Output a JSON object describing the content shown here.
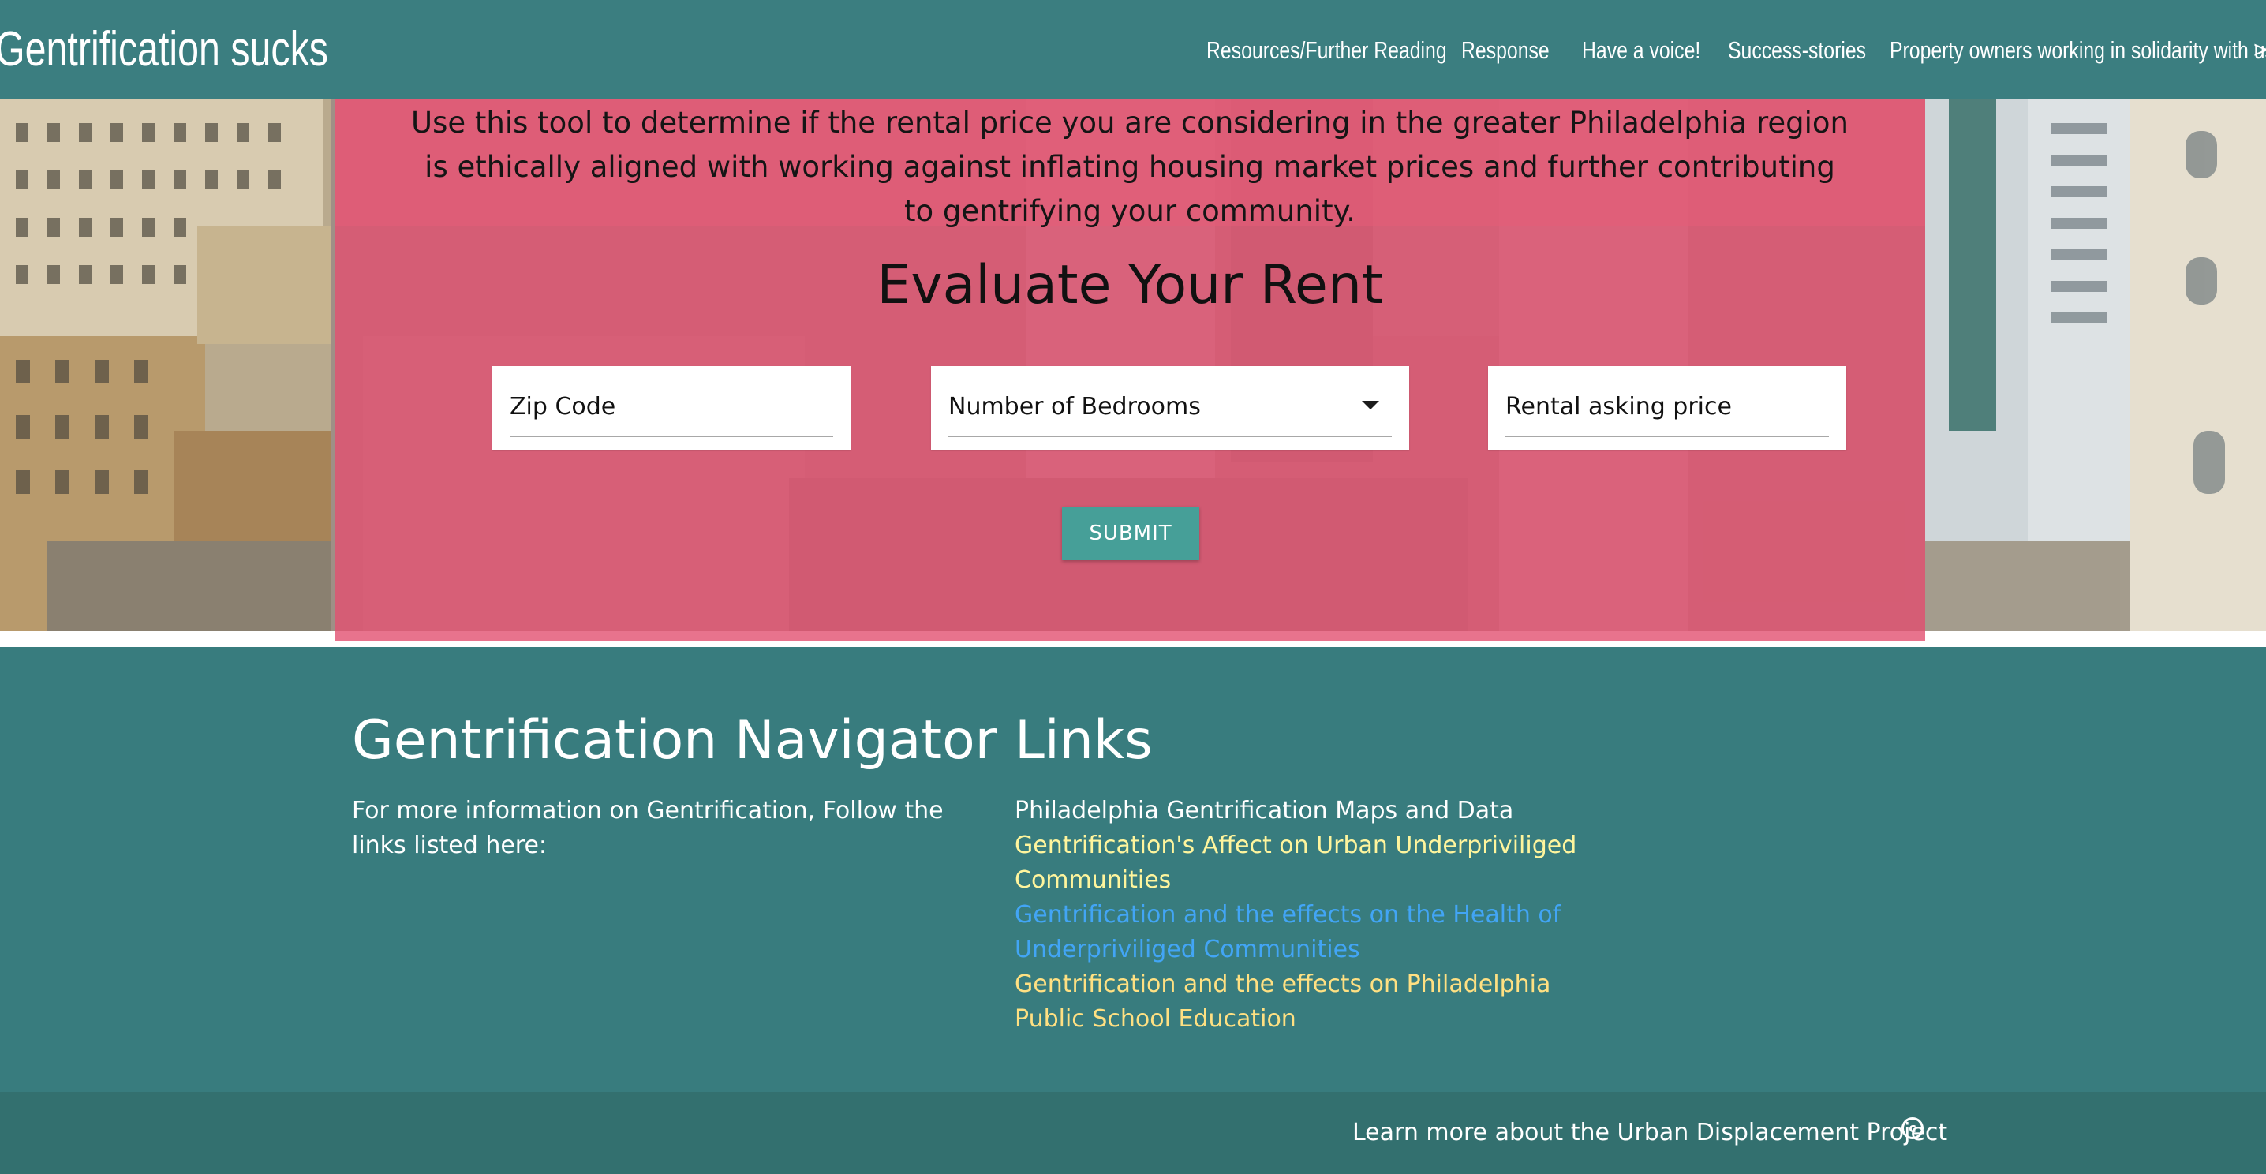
{
  "nav": {
    "brand": "Gentrification sucks",
    "links": [
      {
        "label": "Resources/Further Reading"
      },
      {
        "label": "Response"
      },
      {
        "label": "Have a voice!"
      },
      {
        "label": "Success-stories"
      },
      {
        "label": "Property owners working in solidarity with us"
      }
    ],
    "more": ">"
  },
  "hero": {
    "intro": "Use this tool to determine if the rental price you are considering in the greater Philadelphia region is ethically aligned with working against inflating housing market prices and further contributing to gentrifying your community.",
    "title": "Evaluate Your Rent",
    "zip_placeholder": "Zip Code",
    "bedrooms_placeholder": "Number of Bedrooms",
    "price_placeholder": "Rental asking price",
    "submit_label": "SUBMIT"
  },
  "footer": {
    "navigator_title": "Gentrification Navigator",
    "navigator_text": "For more information on Gentrification, Follow the links listed here:",
    "links_title": "Links",
    "links": [
      {
        "label": "Philadelphia Gentrification Maps and Data",
        "color": "#ffffff"
      },
      {
        "label": "Gentrification's Affect on Urban Underpriviliged Communities",
        "color": "#fff59d"
      },
      {
        "label": "Gentrification and the effects on the Health of Underpriviliged Communities",
        "color": "#42a5f5"
      },
      {
        "label": "Gentrification and the effects on Philadelphia Public School Education",
        "color": "#ffe082"
      }
    ],
    "copyright": "Learn more about the Urban Displacement Project",
    "copyright_symbol": "c"
  },
  "colors": {
    "teal": "#3b7e80",
    "panel_pink": "#e25070",
    "submit": "#469f98"
  }
}
